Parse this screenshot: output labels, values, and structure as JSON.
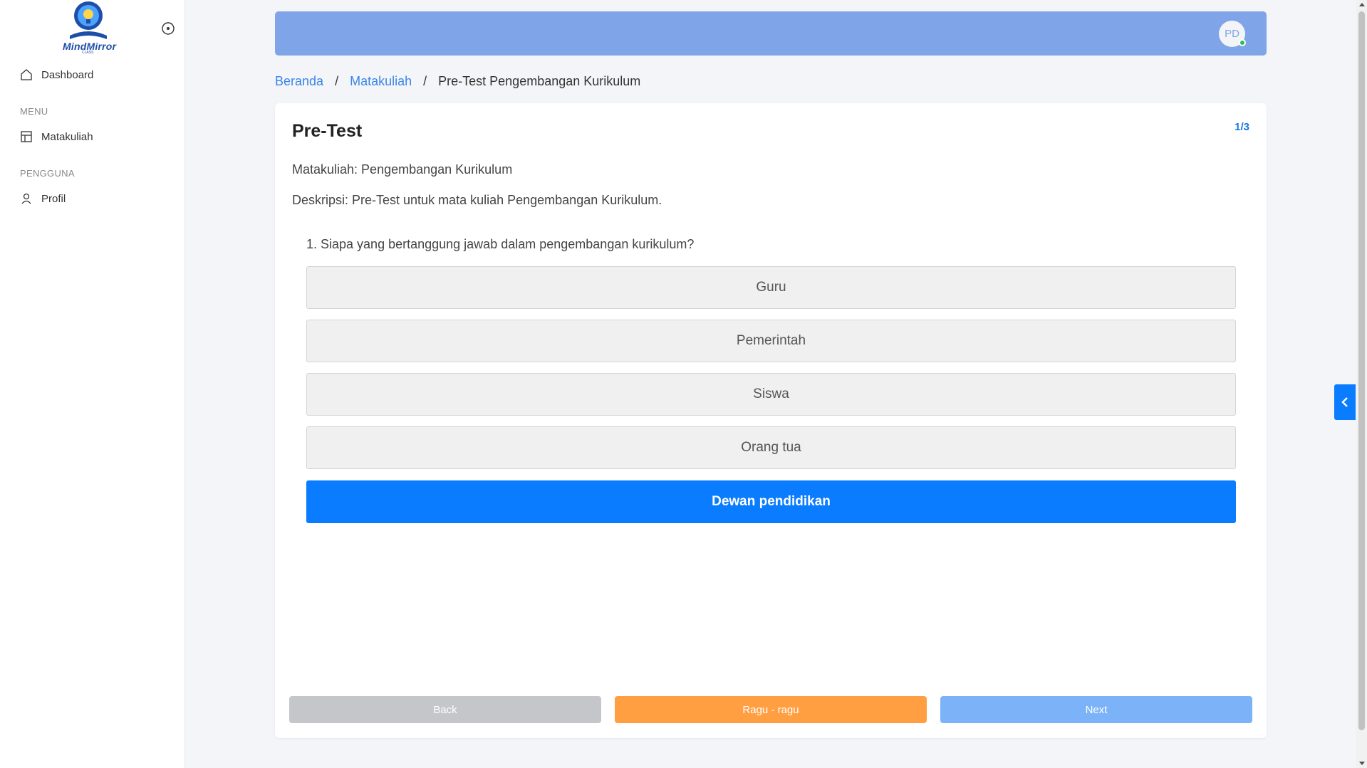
{
  "brand": {
    "name": "MindMirror",
    "subtitle": "CLASS"
  },
  "sidebar": {
    "dashboard_label": "Dashboard",
    "sections": [
      {
        "title": "MENU",
        "items": [
          {
            "label": "Matakuliah",
            "icon": "table-icon"
          }
        ]
      },
      {
        "title": "PENGGUNA",
        "items": [
          {
            "label": "Profil",
            "icon": "user-icon"
          }
        ]
      }
    ]
  },
  "header": {
    "avatar_initials": "PD",
    "status": "online"
  },
  "breadcrumb": {
    "items": [
      "Beranda",
      "Matakuliah"
    ],
    "current": "Pre-Test Pengembangan Kurikulum",
    "separator": "/"
  },
  "quiz": {
    "title": "Pre-Test",
    "counter": "1/3",
    "course_line": "Matakuliah: Pengembangan Kurikulum",
    "description_line": "Deskripsi: Pre-Test untuk mata kuliah Pengembangan Kurikulum.",
    "question": "1. Siapa yang bertanggung jawab dalam pengembangan kurikulum?",
    "options": [
      "Guru",
      "Pemerintah",
      "Siswa",
      "Orang tua",
      "Dewan pendidikan"
    ],
    "selected_option": "Dewan pendidikan",
    "buttons": {
      "back": "Back",
      "doubt": "Ragu - ragu",
      "next": "Next"
    }
  },
  "colors": {
    "topbar": "#7fa5e8",
    "accent": "#0a7cff",
    "doubt": "#ff9f42",
    "next": "#7cb3f8",
    "back": "#c4c6c9"
  }
}
